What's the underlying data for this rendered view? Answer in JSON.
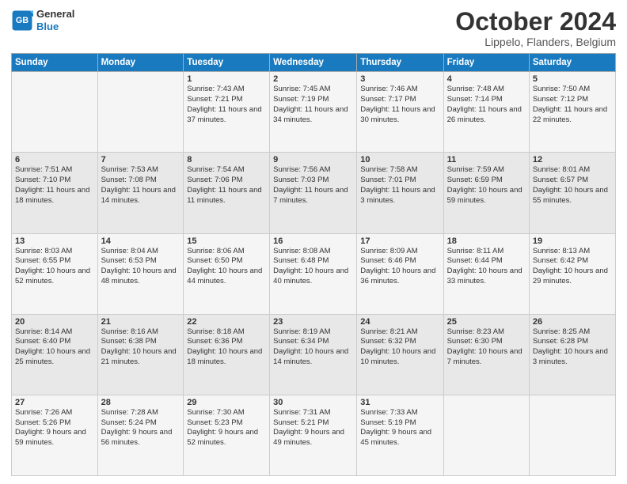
{
  "logo": {
    "line1": "General",
    "line2": "Blue"
  },
  "title": "October 2024",
  "subtitle": "Lippelo, Flanders, Belgium",
  "headers": [
    "Sunday",
    "Monday",
    "Tuesday",
    "Wednesday",
    "Thursday",
    "Friday",
    "Saturday"
  ],
  "weeks": [
    [
      {
        "day": "",
        "info": ""
      },
      {
        "day": "",
        "info": ""
      },
      {
        "day": "1",
        "info": "Sunrise: 7:43 AM\nSunset: 7:21 PM\nDaylight: 11 hours and 37 minutes."
      },
      {
        "day": "2",
        "info": "Sunrise: 7:45 AM\nSunset: 7:19 PM\nDaylight: 11 hours and 34 minutes."
      },
      {
        "day": "3",
        "info": "Sunrise: 7:46 AM\nSunset: 7:17 PM\nDaylight: 11 hours and 30 minutes."
      },
      {
        "day": "4",
        "info": "Sunrise: 7:48 AM\nSunset: 7:14 PM\nDaylight: 11 hours and 26 minutes."
      },
      {
        "day": "5",
        "info": "Sunrise: 7:50 AM\nSunset: 7:12 PM\nDaylight: 11 hours and 22 minutes."
      }
    ],
    [
      {
        "day": "6",
        "info": "Sunrise: 7:51 AM\nSunset: 7:10 PM\nDaylight: 11 hours and 18 minutes."
      },
      {
        "day": "7",
        "info": "Sunrise: 7:53 AM\nSunset: 7:08 PM\nDaylight: 11 hours and 14 minutes."
      },
      {
        "day": "8",
        "info": "Sunrise: 7:54 AM\nSunset: 7:06 PM\nDaylight: 11 hours and 11 minutes."
      },
      {
        "day": "9",
        "info": "Sunrise: 7:56 AM\nSunset: 7:03 PM\nDaylight: 11 hours and 7 minutes."
      },
      {
        "day": "10",
        "info": "Sunrise: 7:58 AM\nSunset: 7:01 PM\nDaylight: 11 hours and 3 minutes."
      },
      {
        "day": "11",
        "info": "Sunrise: 7:59 AM\nSunset: 6:59 PM\nDaylight: 10 hours and 59 minutes."
      },
      {
        "day": "12",
        "info": "Sunrise: 8:01 AM\nSunset: 6:57 PM\nDaylight: 10 hours and 55 minutes."
      }
    ],
    [
      {
        "day": "13",
        "info": "Sunrise: 8:03 AM\nSunset: 6:55 PM\nDaylight: 10 hours and 52 minutes."
      },
      {
        "day": "14",
        "info": "Sunrise: 8:04 AM\nSunset: 6:53 PM\nDaylight: 10 hours and 48 minutes."
      },
      {
        "day": "15",
        "info": "Sunrise: 8:06 AM\nSunset: 6:50 PM\nDaylight: 10 hours and 44 minutes."
      },
      {
        "day": "16",
        "info": "Sunrise: 8:08 AM\nSunset: 6:48 PM\nDaylight: 10 hours and 40 minutes."
      },
      {
        "day": "17",
        "info": "Sunrise: 8:09 AM\nSunset: 6:46 PM\nDaylight: 10 hours and 36 minutes."
      },
      {
        "day": "18",
        "info": "Sunrise: 8:11 AM\nSunset: 6:44 PM\nDaylight: 10 hours and 33 minutes."
      },
      {
        "day": "19",
        "info": "Sunrise: 8:13 AM\nSunset: 6:42 PM\nDaylight: 10 hours and 29 minutes."
      }
    ],
    [
      {
        "day": "20",
        "info": "Sunrise: 8:14 AM\nSunset: 6:40 PM\nDaylight: 10 hours and 25 minutes."
      },
      {
        "day": "21",
        "info": "Sunrise: 8:16 AM\nSunset: 6:38 PM\nDaylight: 10 hours and 21 minutes."
      },
      {
        "day": "22",
        "info": "Sunrise: 8:18 AM\nSunset: 6:36 PM\nDaylight: 10 hours and 18 minutes."
      },
      {
        "day": "23",
        "info": "Sunrise: 8:19 AM\nSunset: 6:34 PM\nDaylight: 10 hours and 14 minutes."
      },
      {
        "day": "24",
        "info": "Sunrise: 8:21 AM\nSunset: 6:32 PM\nDaylight: 10 hours and 10 minutes."
      },
      {
        "day": "25",
        "info": "Sunrise: 8:23 AM\nSunset: 6:30 PM\nDaylight: 10 hours and 7 minutes."
      },
      {
        "day": "26",
        "info": "Sunrise: 8:25 AM\nSunset: 6:28 PM\nDaylight: 10 hours and 3 minutes."
      }
    ],
    [
      {
        "day": "27",
        "info": "Sunrise: 7:26 AM\nSunset: 5:26 PM\nDaylight: 9 hours and 59 minutes."
      },
      {
        "day": "28",
        "info": "Sunrise: 7:28 AM\nSunset: 5:24 PM\nDaylight: 9 hours and 56 minutes."
      },
      {
        "day": "29",
        "info": "Sunrise: 7:30 AM\nSunset: 5:23 PM\nDaylight: 9 hours and 52 minutes."
      },
      {
        "day": "30",
        "info": "Sunrise: 7:31 AM\nSunset: 5:21 PM\nDaylight: 9 hours and 49 minutes."
      },
      {
        "day": "31",
        "info": "Sunrise: 7:33 AM\nSunset: 5:19 PM\nDaylight: 9 hours and 45 minutes."
      },
      {
        "day": "",
        "info": ""
      },
      {
        "day": "",
        "info": ""
      }
    ]
  ]
}
